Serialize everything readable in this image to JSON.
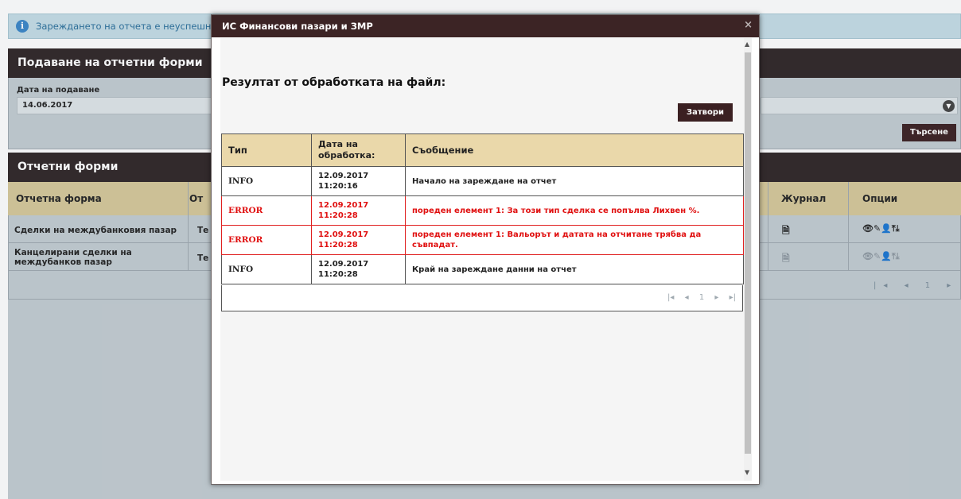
{
  "info": {
    "text": "Зареждането на отчета е неуспешно"
  },
  "submit_panel": {
    "title": "Подаване на отчетни форми",
    "date_label": "Дата на подаване",
    "date_value": "14.06.2017",
    "search_label": "Търсене"
  },
  "forms_panel": {
    "title": "Отчетни форми",
    "columns": [
      "Отчетна форма",
      "От",
      "Журнал",
      "Опции"
    ],
    "rows": [
      {
        "form": "Сделки на междубанковия пазар",
        "from": "Те"
      },
      {
        "form": "Канцелирани сделки на",
        "form2": "междубанков пазар",
        "from": "Те"
      }
    ],
    "pager": "|◂ ◂ 1 ▸ ▸|"
  },
  "modal": {
    "title": "ИС Финансови пазари и ЗМР",
    "close_symbol": "×",
    "result_title": "Резултат от обработката на файл:",
    "close_label": "Затвори",
    "table": {
      "headers": {
        "type": "Тип",
        "date": "Дата на обработка:",
        "message": "Съобщение"
      },
      "rows": [
        {
          "type": "INFO",
          "date": "12.09.2017",
          "time": "11:20:16",
          "message": "Начало на зареждане на отчет",
          "level": "info"
        },
        {
          "type": "ERROR",
          "date": "12.09.2017",
          "time": "11:20:28",
          "message": "пореден елемент 1: За този тип сделка се попълва Лихвен %.",
          "level": "error"
        },
        {
          "type": "ERROR",
          "date": "12.09.2017",
          "time": "11:20:28",
          "message": "пореден елемент 1: Вальорът и датата на отчитане трябва да съвпадат.",
          "level": "error"
        },
        {
          "type": "INFO",
          "date": "12.09.2017",
          "time": "11:20:28",
          "message": "Край на зареждане данни на отчет",
          "level": "info"
        }
      ]
    },
    "pager": {
      "first": "|◂",
      "prev": "◂",
      "page": "1",
      "next": "▸",
      "last": "▸|"
    }
  },
  "colors": {
    "header_dark": "#3c2425",
    "table_header": "#ead8aa",
    "error": "#e01010",
    "info_bar": "#c5dde6"
  }
}
